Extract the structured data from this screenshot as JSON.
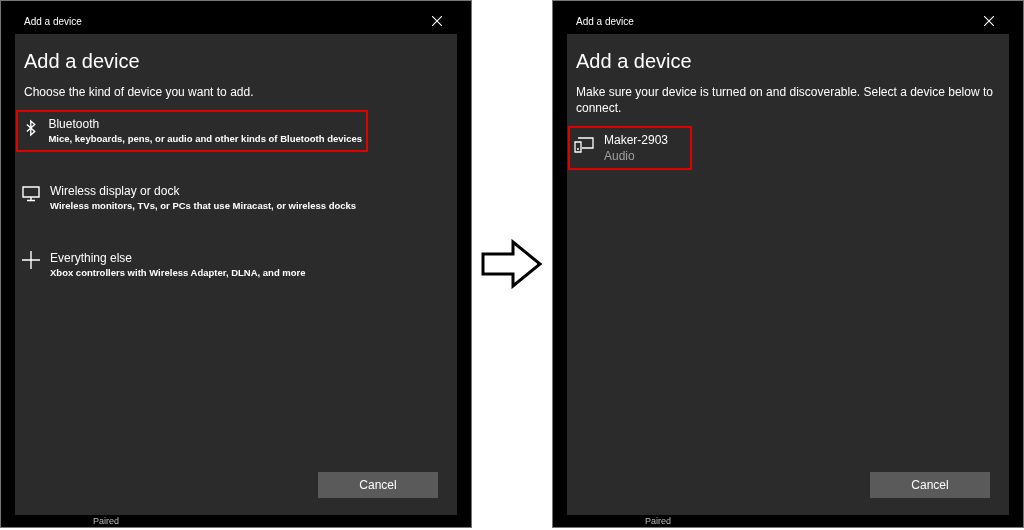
{
  "screens": [
    {
      "window": {
        "title": "Add a device"
      },
      "heading": "Add a device",
      "instruction": "Choose the kind of device you want to add.",
      "items": [
        {
          "kind": "bluetooth",
          "title": "Bluetooth",
          "description": "Mice, keyboards, pens, or audio and other kinds of Bluetooth devices",
          "highlighted": true
        },
        {
          "kind": "display",
          "title": "Wireless display or dock",
          "description": "Wireless monitors, TVs, or PCs that use Miracast, or wireless docks",
          "highlighted": false
        },
        {
          "kind": "other",
          "title": "Everything else",
          "description": "Xbox controllers with Wireless Adapter, DLNA, and more",
          "highlighted": false
        }
      ],
      "buttons": [
        "Cancel"
      ],
      "background_status": "Paired"
    },
    {
      "window": {
        "title": "Add a device"
      },
      "heading": "Add a device",
      "instruction": "Make sure your device is turned on and discoverable. Select a device below to connect.",
      "items": [
        {
          "kind": "device",
          "title": "Maker-2903",
          "description": "Audio",
          "highlighted": true
        }
      ],
      "buttons": [
        "Cancel"
      ],
      "background_status": "Paired"
    }
  ]
}
